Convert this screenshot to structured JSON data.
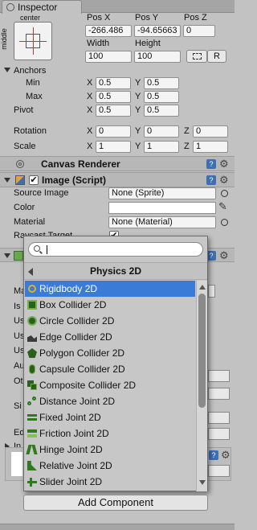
{
  "tab": {
    "title": "Inspector"
  },
  "rect_transform": {
    "anchor_preset_top": "center",
    "anchor_preset_side": "middle",
    "pos_x_label": "Pos X",
    "pos_y_label": "Pos Y",
    "pos_z_label": "Pos Z",
    "pos_x": "-266.486",
    "pos_y": "-94.65663",
    "pos_z": "0",
    "width_label": "Width",
    "height_label": "Height",
    "width": "100",
    "height": "100",
    "r_button": "R",
    "anchors_label": "Anchors",
    "min_label": "Min",
    "max_label": "Max",
    "min_x": "0.5",
    "min_y": "0.5",
    "max_x": "0.5",
    "max_y": "0.5",
    "pivot_label": "Pivot",
    "pivot_x": "0.5",
    "pivot_y": "0.5",
    "rotation_label": "Rotation",
    "rot_x": "0",
    "rot_y": "0",
    "rot_z": "0",
    "scale_label": "Scale",
    "scale_x": "1",
    "scale_y": "1",
    "scale_z": "1",
    "x": "X",
    "y": "Y",
    "z": "Z"
  },
  "canvas_renderer": {
    "title": "Canvas Renderer"
  },
  "image_script": {
    "title": "Image (Script)",
    "source_image_label": "Source Image",
    "source_image_value": "None (Sprite)",
    "color_label": "Color",
    "material_label": "Material",
    "material_value": "None (Material)",
    "raycast_label": "Raycast Target"
  },
  "hidden_fragments": {
    "ma": "Ma",
    "is": "Is",
    "us1": "Us",
    "us2": "Us",
    "us3": "Us",
    "au": "Au",
    "ot": "Ot",
    "si": "Si",
    "ed": "Ed",
    "in": "In"
  },
  "popup": {
    "search_value": "",
    "category": "Physics 2D",
    "items": [
      "Rigidbody 2D",
      "Box Collider 2D",
      "Circle Collider 2D",
      "Edge Collider 2D",
      "Polygon Collider 2D",
      "Capsule Collider 2D",
      "Composite Collider 2D",
      "Distance Joint 2D",
      "Fixed Joint 2D",
      "Friction Joint 2D",
      "Hinge Joint 2D",
      "Relative Joint 2D",
      "Slider Joint 2D"
    ],
    "selected_index": 0
  },
  "add_component": {
    "label": "Add Component"
  },
  "colors": {
    "selection": "#3b7bd8",
    "panel": "#c2c2c2",
    "header": "#b7b7b7"
  }
}
